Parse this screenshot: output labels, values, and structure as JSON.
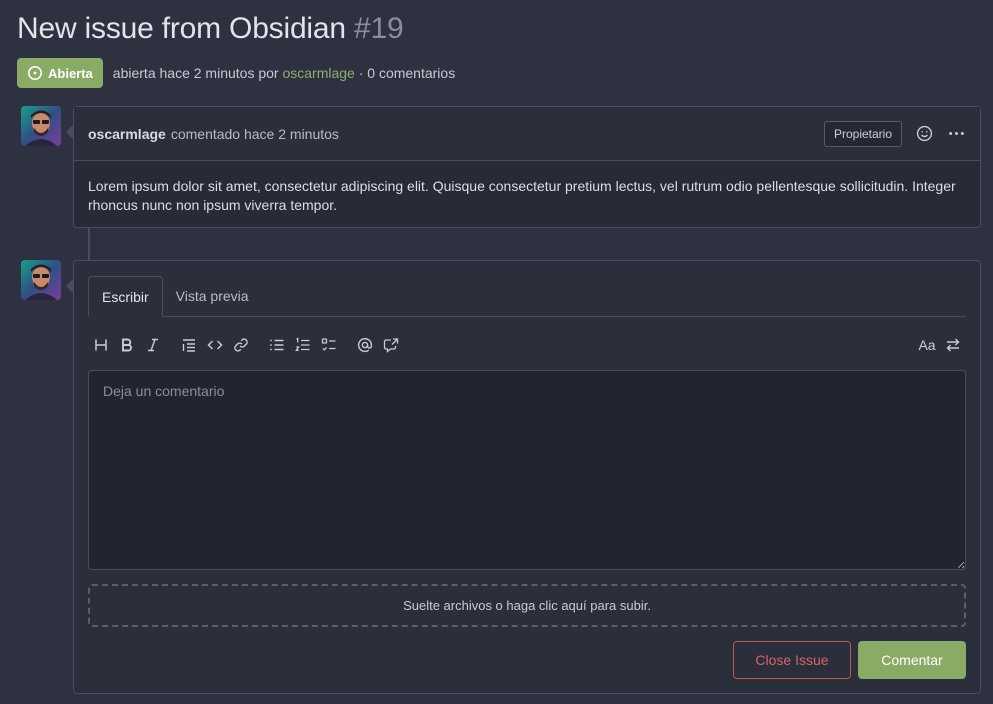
{
  "issue": {
    "title": "New issue from Obsidian",
    "number": "#19",
    "status_label": "Abierta",
    "meta_prefix": "abierta hace 2 minutos por",
    "meta_author": "oscarmlage",
    "meta_suffix": "· 0 comentarios"
  },
  "comment": {
    "author": "oscarmlage",
    "when": "comentado hace 2 minutos",
    "role_badge": "Propietario",
    "body": "Lorem ipsum dolor sit amet, consectetur adipiscing elit. Quisque consectetur pretium lectus, vel rutrum odio pellentesque sollicitudin. Integer rhoncus nunc non ipsum viverra tempor."
  },
  "editor": {
    "tabs": [
      {
        "label": "Escribir"
      },
      {
        "label": "Vista previa"
      }
    ],
    "toolbar": {
      "heading": "H",
      "bold": "B",
      "italic": "I",
      "font_toggle": "Aa"
    },
    "placeholder": "Deja un comentario",
    "dropzone_text": "Suelte archivos o haga clic aquí para subir.",
    "close_button": "Close Issue",
    "comment_button": "Comentar"
  },
  "colors": {
    "accent_green": "#8aab66",
    "danger_red": "#d66662",
    "background": "#2e3140"
  }
}
